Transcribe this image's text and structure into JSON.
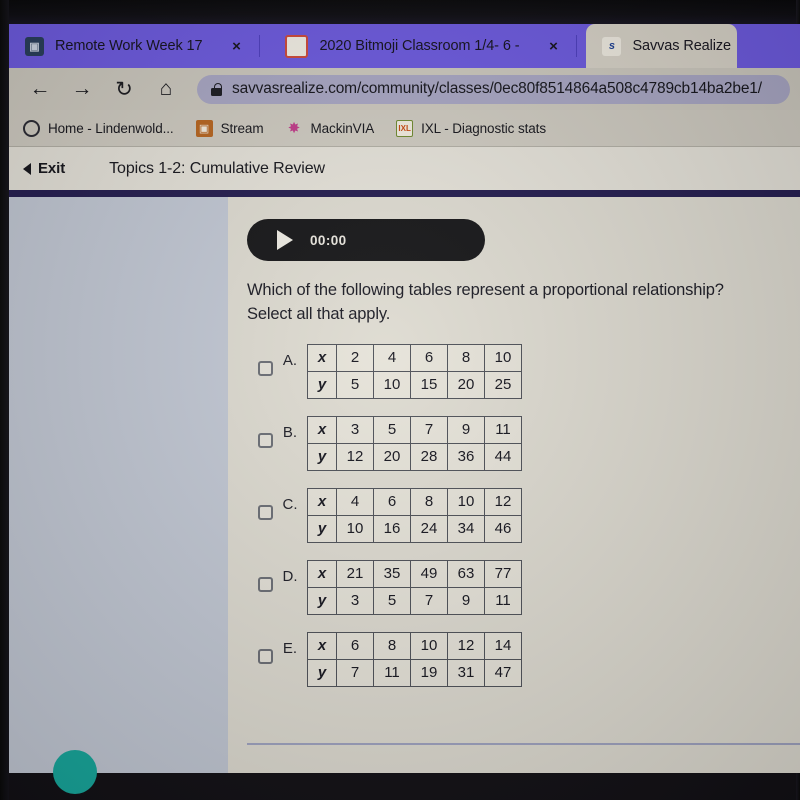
{
  "browser": {
    "tabs": [
      {
        "title": "Remote Work Week 17",
        "favicon": "classroom-icon",
        "favicon_glyph": "▣",
        "close": "×",
        "active": false
      },
      {
        "title": "2020 Bitmoji Classroom 1/4- 6 -",
        "favicon": "bitmoji-icon",
        "favicon_glyph": "",
        "close": "×",
        "active": false
      },
      {
        "title": "Savvas Realize",
        "favicon": "savvas-icon",
        "favicon_glyph": "s",
        "close": "",
        "active": true
      }
    ],
    "toolbar": {
      "back": "←",
      "forward": "→",
      "reload": "↻",
      "home": "⌂",
      "lock": "lock-icon",
      "url": "savvasrealize.com/community/classes/0ec80f8514864a508c4789cb14ba2be1/"
    },
    "bookmarks": [
      {
        "label": "Home - Lindenwold...",
        "icon": "home-icon",
        "glyph": ""
      },
      {
        "label": "Stream",
        "icon": "stream-icon",
        "glyph": "▣"
      },
      {
        "label": "MackinVIA",
        "icon": "mackinvia-icon",
        "glyph": "✸"
      },
      {
        "label": "IXL - Diagnostic stats",
        "icon": "ixl-icon",
        "glyph": "IXL"
      }
    ]
  },
  "app": {
    "exit_label": "Exit",
    "exit_chevron": "‹",
    "topic_title": "Topics 1-2: Cumulative Review"
  },
  "player": {
    "play_glyph": "▶",
    "timecode": "00:00"
  },
  "question": {
    "line1": "Which of the following tables represent a proportional relationship?",
    "line2": "Select all that apply."
  },
  "options": [
    {
      "letter": "A.",
      "checked": false,
      "table": {
        "row_labels": [
          "x",
          "y"
        ],
        "x": [
          "2",
          "4",
          "6",
          "8",
          "10"
        ],
        "y": [
          "5",
          "10",
          "15",
          "20",
          "25"
        ]
      }
    },
    {
      "letter": "B.",
      "checked": false,
      "table": {
        "row_labels": [
          "x",
          "y"
        ],
        "x": [
          "3",
          "5",
          "7",
          "9",
          "11"
        ],
        "y": [
          "12",
          "20",
          "28",
          "36",
          "44"
        ]
      }
    },
    {
      "letter": "C.",
      "checked": false,
      "table": {
        "row_labels": [
          "x",
          "y"
        ],
        "x": [
          "4",
          "6",
          "8",
          "10",
          "12"
        ],
        "y": [
          "10",
          "16",
          "24",
          "34",
          "46"
        ]
      }
    },
    {
      "letter": "D.",
      "checked": false,
      "table": {
        "row_labels": [
          "x",
          "y"
        ],
        "x": [
          "21",
          "35",
          "49",
          "63",
          "77"
        ],
        "y": [
          "3",
          "5",
          "7",
          "9",
          "11"
        ]
      }
    },
    {
      "letter": "E.",
      "checked": false,
      "table": {
        "row_labels": [
          "x",
          "y"
        ],
        "x": [
          "6",
          "8",
          "10",
          "12",
          "14"
        ],
        "y": [
          "7",
          "11",
          "19",
          "31",
          "47"
        ]
      }
    }
  ],
  "colors": {
    "tabstrip_purple": "#6d5ae0",
    "navy_rule": "#241d50",
    "player_black": "#161618",
    "teal_accent": "#17a79c",
    "left_rail": "#c2c8d4"
  }
}
